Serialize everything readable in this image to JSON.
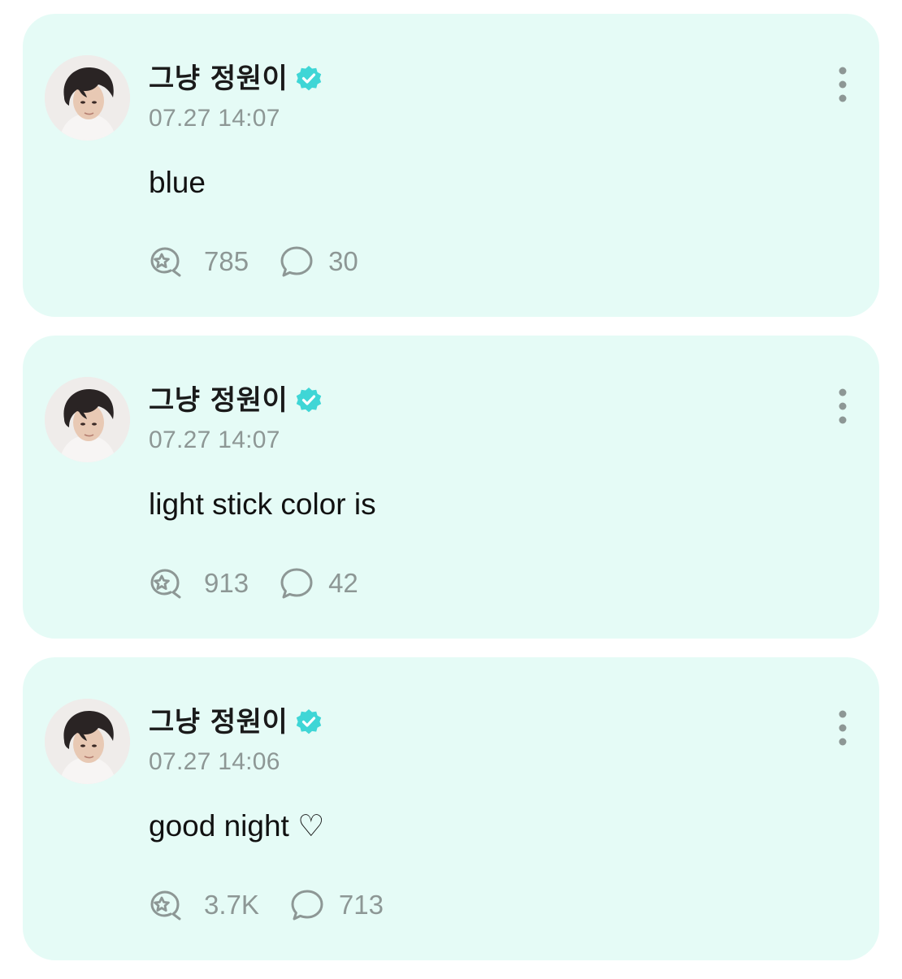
{
  "colors": {
    "card_background": "#e5fbf6",
    "verified_badge": "#3fd6d6",
    "meta_text": "#8d9795",
    "icon_stroke": "#8d9795"
  },
  "posts": [
    {
      "author": "그냥 정원이",
      "verified_icon": "verified-badge-icon",
      "timestamp": "07.27 14:07",
      "text": "blue",
      "likes": "785",
      "comments": "30"
    },
    {
      "author": "그냥 정원이",
      "verified_icon": "verified-badge-icon",
      "timestamp": "07.27 14:07",
      "text": "light stick color is",
      "likes": "913",
      "comments": "42"
    },
    {
      "author": "그냥 정원이",
      "verified_icon": "verified-badge-icon",
      "timestamp": "07.27 14:06",
      "text": "good night ♡",
      "likes": "3.7K",
      "comments": "713"
    }
  ]
}
